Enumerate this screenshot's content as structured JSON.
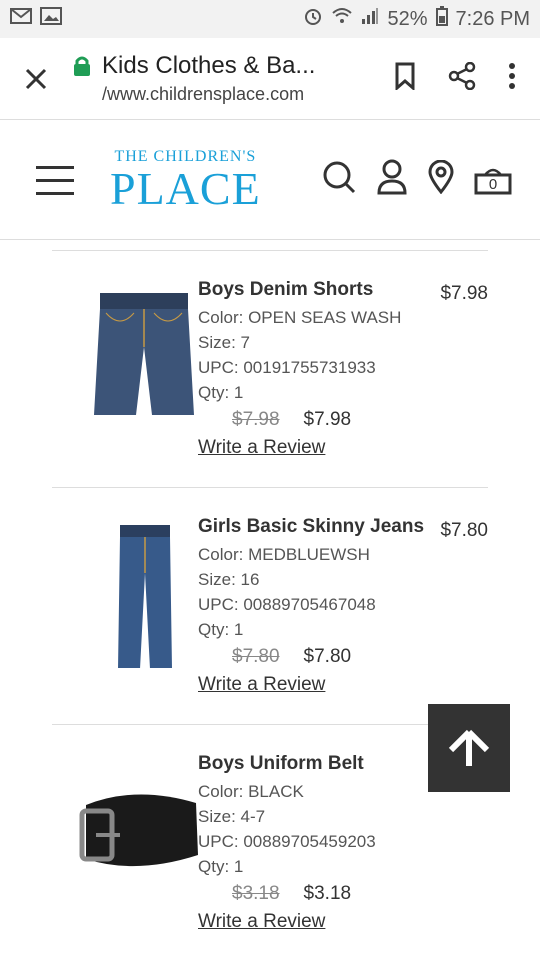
{
  "status": {
    "battery": "52%",
    "time": "7:26 PM"
  },
  "browser": {
    "title": "Kids Clothes & Ba...",
    "url": "/www.childrensplace.com"
  },
  "logo": {
    "line1": "THE CHILDREN'S",
    "line2": "PLACE"
  },
  "cart": {
    "count": "0"
  },
  "items": [
    {
      "name": "Boys Denim Shorts",
      "color": "Color: OPEN SEAS WASH",
      "size": "Size: 7",
      "upc": "UPC: 00191755731933",
      "qty": "Qty: 1",
      "old_price": "$7.98",
      "price": "$7.98",
      "total": "$7.98",
      "review": "Write a Review"
    },
    {
      "name": "Girls Basic Skinny Jeans",
      "color": "Color: MEDBLUEWSH",
      "size": "Size: 16",
      "upc": "UPC: 00889705467048",
      "qty": "Qty: 1",
      "old_price": "$7.80",
      "price": "$7.80",
      "total": "$7.80",
      "review": "Write a Review"
    },
    {
      "name": "Boys Uniform Belt",
      "color": "Color: BLACK",
      "size": "Size: 4-7",
      "upc": "UPC: 00889705459203",
      "qty": "Qty: 1",
      "old_price": "$3.18",
      "price": "$3.18",
      "total": "$3.18",
      "review": "Write a Review"
    }
  ],
  "icons": {
    "scroll_top": "arrow-up-icon"
  }
}
